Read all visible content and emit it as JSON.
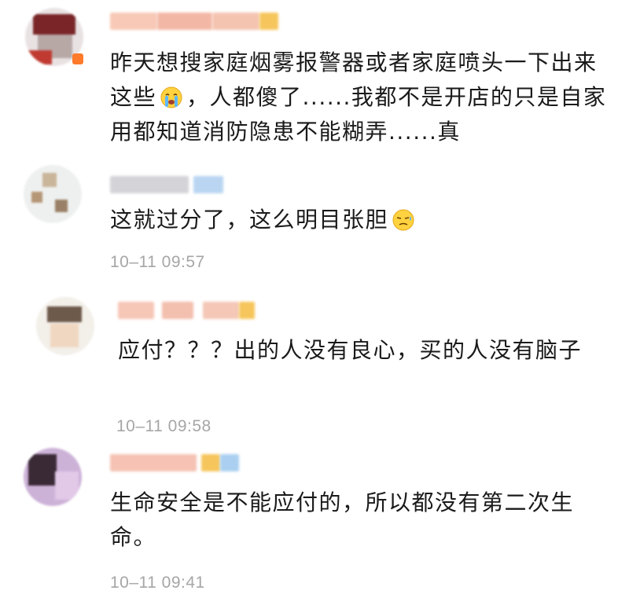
{
  "comments": [
    {
      "body_before": "昨天想搜家庭烟雾报警器或者家庭喷头一下出来这些",
      "emoji": "crying-face-emoji",
      "body_after": "，人都傻了......我都不是开店的只是自家用都知道消防隐患不能糊弄......真",
      "time": ""
    },
    {
      "body_before": "这就过分了，这么明目张胆",
      "emoji": "sweat-face-emoji",
      "body_after": "",
      "time": "10–11 09:57"
    },
    {
      "body_before": "应付？？？出的人没有良心，买的人没有脑子",
      "emoji": "",
      "body_after": "",
      "time": "10–11 09:58"
    },
    {
      "body_before": "生命安全是不能应付的，所以都没有第二次生命。",
      "emoji": "",
      "body_after": "",
      "time": "10–11 09:41"
    }
  ],
  "colors": {
    "text": "#1a1a1a",
    "timestamp": "#a6a6a6",
    "nick_blur": "#f4b8a8",
    "badge_orange": "#ff7a2b",
    "badge_blue": "#9cc6f2"
  }
}
